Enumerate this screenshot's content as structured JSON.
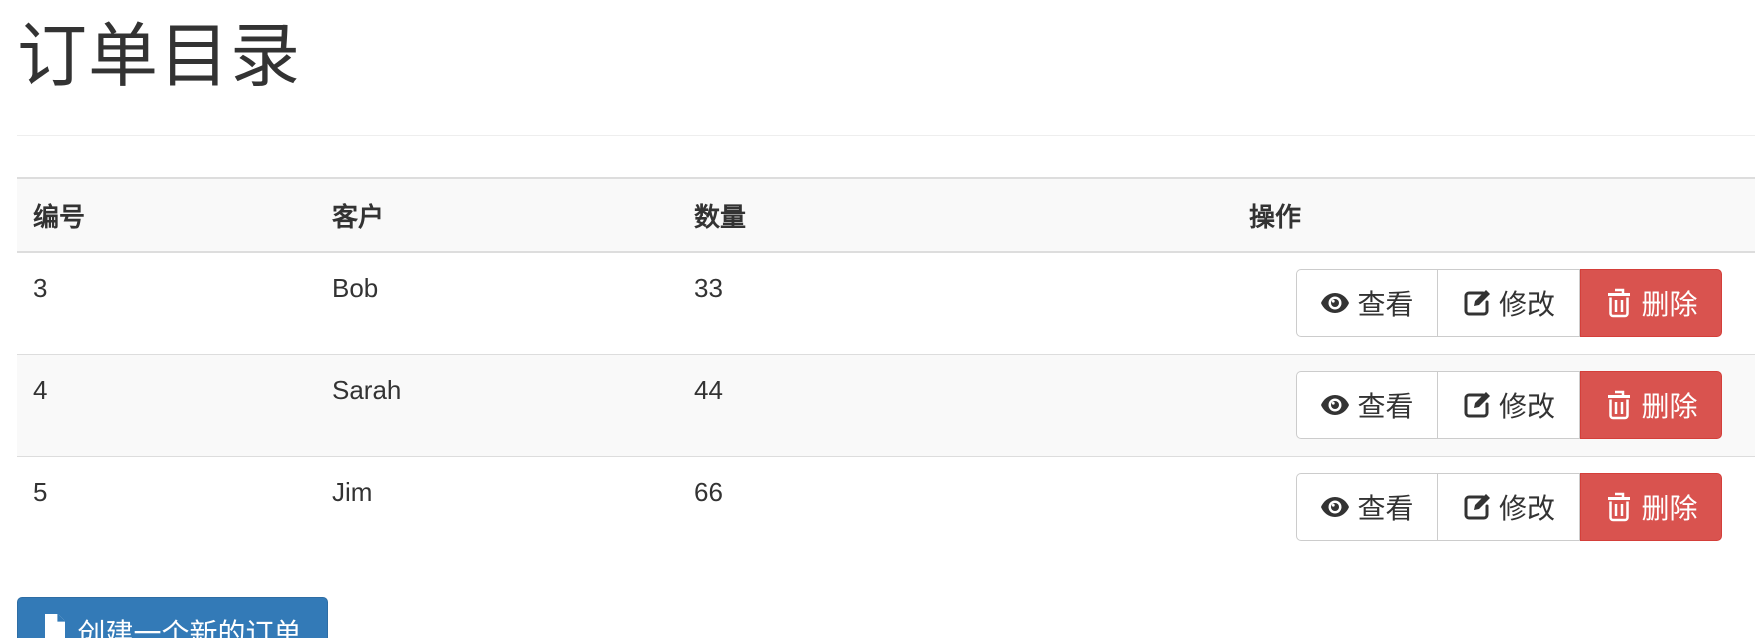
{
  "header": {
    "title": "订单目录"
  },
  "table": {
    "columns": [
      "编号",
      "客户",
      "数量",
      "操作"
    ],
    "rows": [
      {
        "id": "3",
        "customer": "Bob",
        "quantity": "33"
      },
      {
        "id": "4",
        "customer": "Sarah",
        "quantity": "44"
      },
      {
        "id": "5",
        "customer": "Jim",
        "quantity": "66"
      }
    ]
  },
  "actions": {
    "view_label": "查看",
    "edit_label": "修改",
    "delete_label": "删除",
    "view_icon": "eye-icon",
    "edit_icon": "edit-icon",
    "delete_icon": "trash-icon"
  },
  "footer": {
    "create_label": "创建一个新的订单",
    "create_icon": "file-icon"
  },
  "colors": {
    "primary": "#337ab7",
    "danger": "#d9534f",
    "text": "#333333",
    "stripe": "#f9f9f9",
    "border": "#dddddd"
  }
}
